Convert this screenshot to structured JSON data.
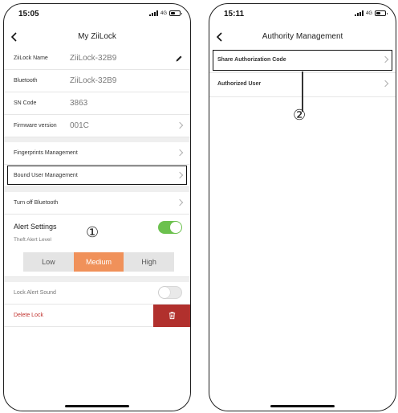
{
  "left_phone": {
    "status": {
      "time": "15:05",
      "network": "4G"
    },
    "title": "My ZiiLock",
    "rows": {
      "name": {
        "label": "ZiiLock Name",
        "value": "ZiiLock-32B9"
      },
      "bluetooth": {
        "label": "Bluetooth",
        "value": "ZiiLock-32B9"
      },
      "sn": {
        "label": "SN Code",
        "value": "3863"
      },
      "firmware": {
        "label": "Firmware version",
        "value": "001C"
      },
      "fingerprints": {
        "label": "Fingerprints Management"
      },
      "bound_users": {
        "label": "Bound User Management"
      },
      "bluetooth_off": {
        "label": "Turn off Bluetooth"
      },
      "lock_alert_sound": {
        "label": "Lock Alert Sound",
        "on": false
      },
      "delete_lock": {
        "label": "Delete Lock"
      }
    },
    "alert": {
      "title": "Alert Settings",
      "subtitle": "Theft Alert Level",
      "enabled": true,
      "levels": [
        "Low",
        "Medium",
        "High"
      ],
      "selected_level": "Medium"
    },
    "annotation": "①",
    "colors": {
      "accent": "#f0915a",
      "toggle_on": "#6cc14e",
      "danger": "#b1302d"
    }
  },
  "right_phone": {
    "status": {
      "time": "15:11",
      "network": "4G"
    },
    "title": "Authority Management",
    "rows": {
      "share_code": {
        "label": "Share Authorization Code"
      },
      "authorized_user": {
        "label": "Authorized User"
      }
    },
    "annotation": "②"
  }
}
